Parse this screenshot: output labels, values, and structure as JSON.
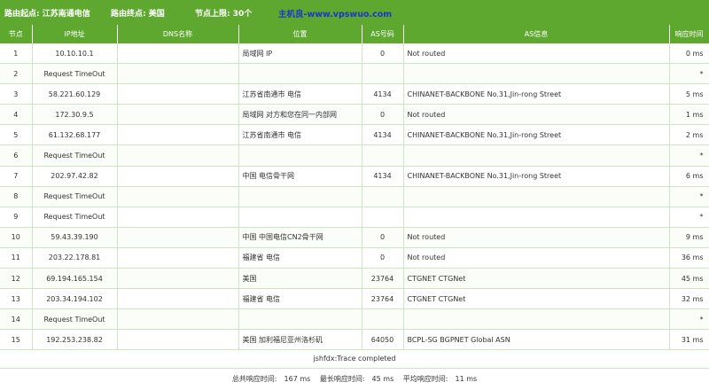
{
  "header": {
    "start_label": "路由起点: 江苏南通电信",
    "end_label": "路由终点: 美国",
    "hops_label": "节点上限: 30个",
    "watermark": "主机良-www.vpswuo.com"
  },
  "columns": [
    "节点",
    "IP地址",
    "DNS名称",
    "位置",
    "AS号码",
    "AS信息",
    "响应时间"
  ],
  "rows": [
    {
      "hop": "1",
      "ip": "10.10.10.1",
      "dns": "",
      "loc": "局域网 IP",
      "asn": "0",
      "asinfo": "Not routed",
      "rt": "0 ms"
    },
    {
      "hop": "2",
      "ip": "Request TimeOut",
      "dns": "",
      "loc": "",
      "asn": "",
      "asinfo": "",
      "rt": "*"
    },
    {
      "hop": "3",
      "ip": "58.221.60.129",
      "dns": "",
      "loc": "江苏省南通市 电信",
      "asn": "4134",
      "asinfo": "CHINANET-BACKBONE No.31,Jin-rong Street",
      "rt": "5 ms"
    },
    {
      "hop": "4",
      "ip": "172.30.9.5",
      "dns": "",
      "loc": "局域网 对方和您在同一内部网",
      "asn": "0",
      "asinfo": "Not routed",
      "rt": "1 ms"
    },
    {
      "hop": "5",
      "ip": "61.132.68.177",
      "dns": "",
      "loc": "江苏省南通市 电信",
      "asn": "4134",
      "asinfo": "CHINANET-BACKBONE No.31,Jin-rong Street",
      "rt": "2 ms"
    },
    {
      "hop": "6",
      "ip": "Request TimeOut",
      "dns": "",
      "loc": "",
      "asn": "",
      "asinfo": "",
      "rt": "*"
    },
    {
      "hop": "7",
      "ip": "202.97.42.82",
      "dns": "",
      "loc": "中国 电信骨干网",
      "asn": "4134",
      "asinfo": "CHINANET-BACKBONE No.31,Jin-rong Street",
      "rt": "6 ms"
    },
    {
      "hop": "8",
      "ip": "Request TimeOut",
      "dns": "",
      "loc": "",
      "asn": "",
      "asinfo": "",
      "rt": "*"
    },
    {
      "hop": "9",
      "ip": "Request TimeOut",
      "dns": "",
      "loc": "",
      "asn": "",
      "asinfo": "",
      "rt": "*"
    },
    {
      "hop": "10",
      "ip": "59.43.39.190",
      "dns": "",
      "loc": "中国 中国电信CN2骨干网",
      "asn": "0",
      "asinfo": "Not routed",
      "rt": "9 ms"
    },
    {
      "hop": "11",
      "ip": "203.22.178.81",
      "dns": "",
      "loc": "福建省 电信",
      "asn": "0",
      "asinfo": "Not routed",
      "rt": "36 ms"
    },
    {
      "hop": "12",
      "ip": "69.194.165.154",
      "dns": "",
      "loc": "美国",
      "asn": "23764",
      "asinfo": "CTGNET CTGNet",
      "rt": "45 ms"
    },
    {
      "hop": "13",
      "ip": "203.34.194.102",
      "dns": "",
      "loc": "福建省 电信",
      "asn": "23764",
      "asinfo": "CTGNET CTGNet",
      "rt": "32 ms"
    },
    {
      "hop": "14",
      "ip": "Request TimeOut",
      "dns": "",
      "loc": "",
      "asn": "",
      "asinfo": "",
      "rt": "*"
    },
    {
      "hop": "15",
      "ip": "192.253.238.82",
      "dns": "",
      "loc": "美国 加利福尼亚州洛杉矶",
      "asn": "64050",
      "asinfo": "BCPL-SG BGPNET Global ASN",
      "rt": "31 ms"
    }
  ],
  "footer": {
    "status": "jshfdx:Trace completed",
    "total_label": "总共响应时间:",
    "total_value": "167 ms",
    "max_label": "最长响应时间:",
    "max_value": "45 ms",
    "avg_label": "平均响应时间:",
    "avg_value": "11 ms"
  },
  "colors": {
    "header_green": "#5ea830",
    "watermark_blue": "#1c36c8"
  }
}
